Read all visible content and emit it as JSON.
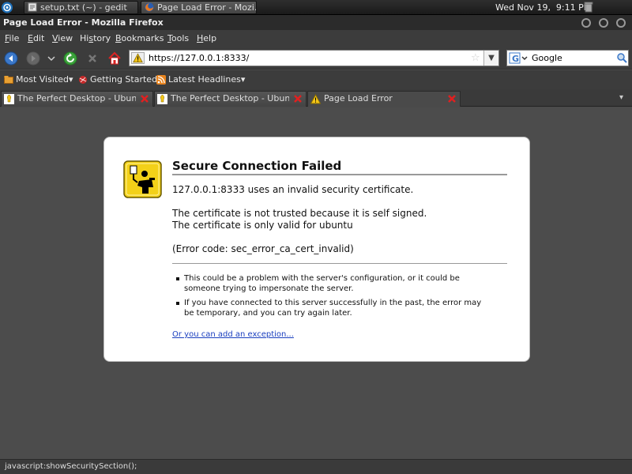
{
  "panel": {
    "tasks": [
      {
        "label": "setup.txt (~) - gedit",
        "icon": "text-editor-icon"
      },
      {
        "label": "Page Load Error - Mozi...",
        "icon": "firefox-icon"
      }
    ],
    "clock": "Wed Nov 19,  9:11 PM"
  },
  "window": {
    "title": "Page Load Error - Mozilla Firefox"
  },
  "menubar": {
    "items": [
      {
        "key": "F",
        "rest": "ile"
      },
      {
        "key": "E",
        "rest": "dit"
      },
      {
        "key": "V",
        "rest": "iew"
      },
      {
        "pre": "Hi",
        "key": "s",
        "rest": "tory"
      },
      {
        "key": "B",
        "rest": "ookmarks"
      },
      {
        "key": "T",
        "rest": "ools"
      },
      {
        "key": "H",
        "rest": "elp"
      }
    ]
  },
  "navbar": {
    "url": "https://127.0.0.1:8333/",
    "search_value": "Google",
    "search_engine": "Google"
  },
  "bookmarks": {
    "items": [
      {
        "label": "Most Visited",
        "icon": "smart-folder-icon",
        "dropdown": "▾"
      },
      {
        "label": "Getting Started",
        "icon": "firefox-bookmark-icon"
      },
      {
        "label": "Latest Headlines",
        "icon": "rss-feed-icon",
        "dropdown": "▾"
      }
    ]
  },
  "tabs": [
    {
      "label": "The Perfect Desktop - Ubunt...",
      "active": false
    },
    {
      "label": "The Perfect Desktop - Ubunt...",
      "active": false
    },
    {
      "label": "Page Load Error",
      "active": true
    }
  ],
  "error": {
    "title": "Secure Connection Failed",
    "line1": "127.0.0.1:8333 uses an invalid security certificate.",
    "line2": "The certificate is not trusted because it is self signed.",
    "line3": "The certificate is only valid for ubuntu",
    "code": "(Error code: sec_error_ca_cert_invalid)",
    "bullets": [
      "This could be a problem with the server's configuration, or it could be someone trying to impersonate the server.",
      "If you have connected to this server successfully in the past, the error may be temporary, and you can try again later."
    ],
    "link": "Or you can add an exception..."
  },
  "status": {
    "text": "javascript:showSecuritySection();"
  },
  "colors": {
    "link": "#1a3fbf",
    "chrome": "#3c3c3c",
    "content_bg": "#4c4c4c"
  }
}
